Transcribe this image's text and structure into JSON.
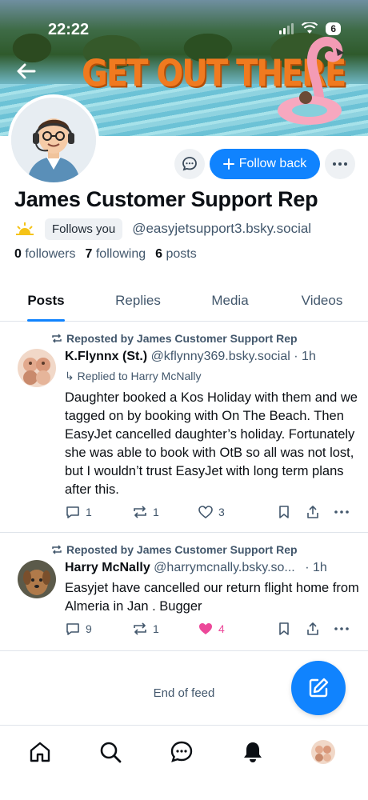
{
  "status_bar": {
    "time": "22:22",
    "battery": "6"
  },
  "banner": {
    "headline": "GET OUT THERE"
  },
  "profile": {
    "display_name": "James Customer Support Rep",
    "follows_you": "Follows you",
    "handle": "@easyjetsupport3.bsky.social",
    "followers_count": "0",
    "followers_label": "followers",
    "following_count": "7",
    "following_label": "following",
    "posts_count": "6",
    "posts_label": "posts",
    "follow_back_label": "Follow back"
  },
  "tabs": [
    {
      "label": "Posts",
      "active": true
    },
    {
      "label": "Replies",
      "active": false
    },
    {
      "label": "Media",
      "active": false
    },
    {
      "label": "Videos",
      "active": false
    }
  ],
  "posts": [
    {
      "repost_label": "Reposted by James Customer Support Rep",
      "author": "K.Flynnx (St.)",
      "handle": "@kflynny369.bsky.social",
      "time": "· 1h",
      "reply_to": "Replied to Harry McNally",
      "text": "Daughter booked a Kos Holiday with them and we tagged on by booking with On The Beach. Then EasyJet cancelled daughter’s holiday. Fortunately she was able to book with OtB so all was not lost, but I wouldn’t trust EasyJet with long term plans after this.",
      "replies": "1",
      "reposts": "1",
      "likes": "3",
      "liked": false
    },
    {
      "repost_label": "Reposted by James Customer Support Rep",
      "author": "Harry McNally",
      "handle": "@harrymcnally.bsky.so...",
      "time": "· 1h",
      "text": "Easyjet have cancelled our return flight home from Almeria in Jan . Bugger",
      "replies": "9",
      "reposts": "1",
      "likes": "4",
      "liked": true
    }
  ],
  "feed_end": "End of feed",
  "colors": {
    "accent": "#1083fe",
    "liked": "#ec4899",
    "muted": "#42576c"
  }
}
